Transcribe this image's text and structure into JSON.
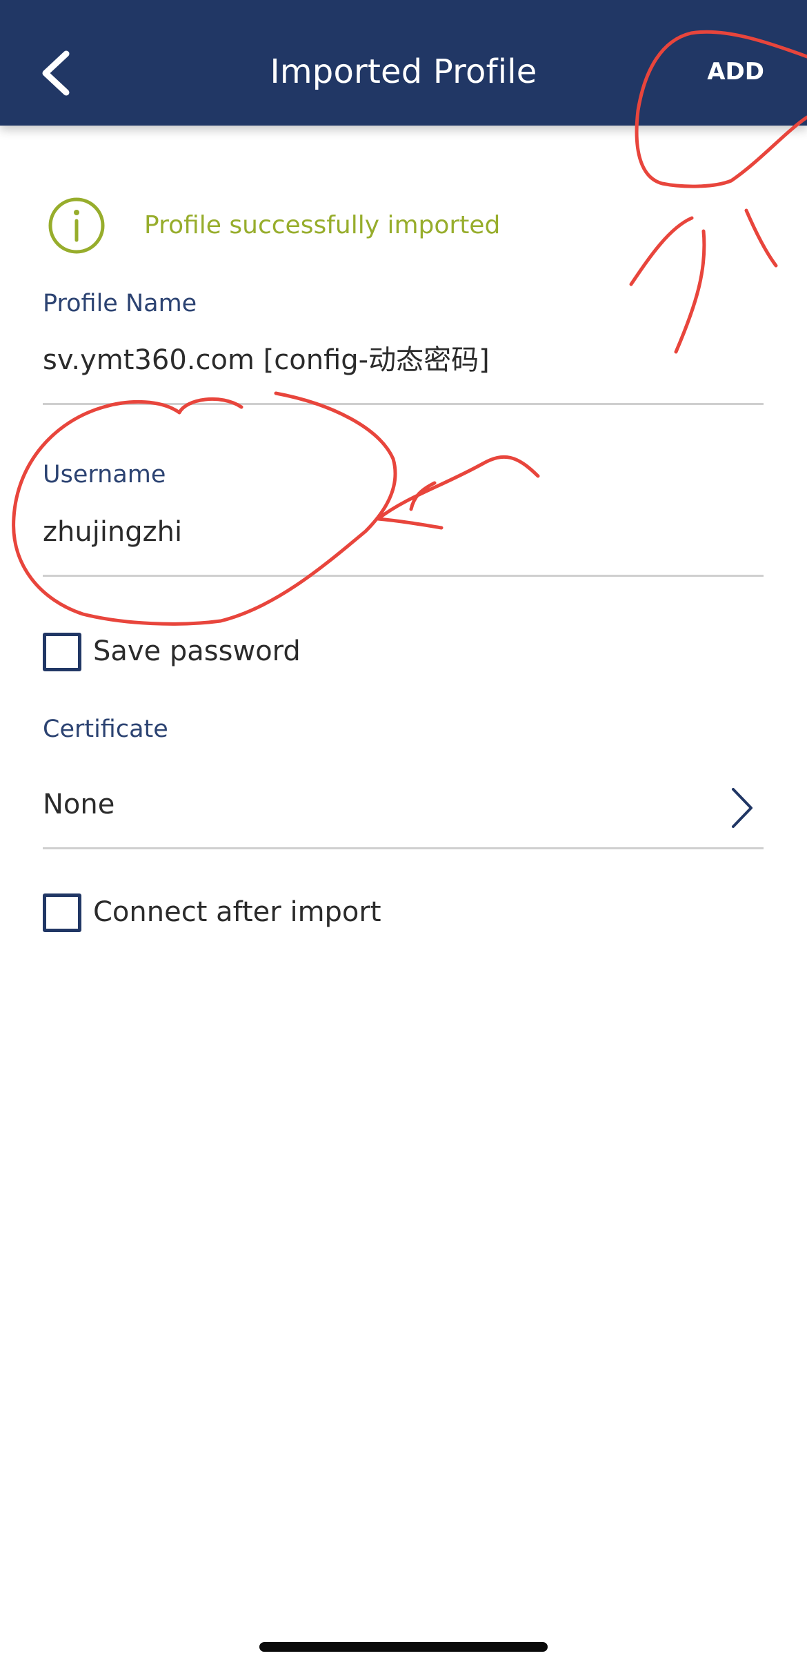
{
  "header": {
    "title": "Imported Profile",
    "add_label": "ADD",
    "back_icon": "chevron-left-icon",
    "background": "#213765"
  },
  "status": {
    "icon": "info-circle-icon",
    "message": "Profile successfully imported",
    "color": "#97ad2c"
  },
  "profile_name": {
    "label": "Profile Name",
    "value": "sv.ymt360.com [config-动态密码]"
  },
  "username": {
    "label": "Username",
    "value": "zhujingzhi"
  },
  "save_password": {
    "label": "Save password",
    "checked": false
  },
  "certificate": {
    "label": "Certificate",
    "value": "None",
    "icon": "chevron-right-icon"
  },
  "connect_after_import": {
    "label": "Connect after import",
    "checked": false
  },
  "colors": {
    "accent": "#213765",
    "label": "#2c4372",
    "success": "#97ad2c",
    "annotation": "#e8453c"
  }
}
